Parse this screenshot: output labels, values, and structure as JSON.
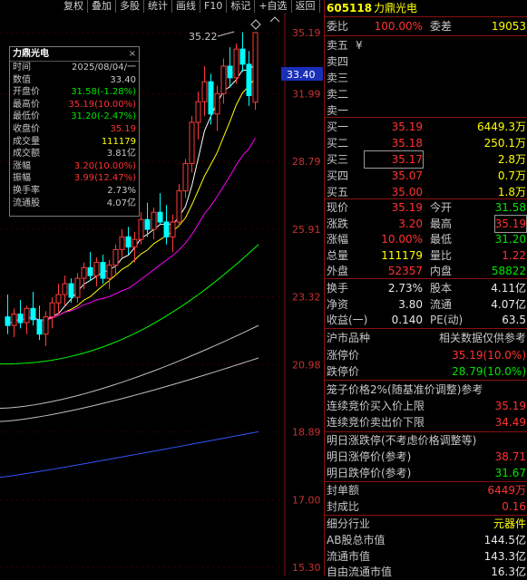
{
  "toolbar": {
    "items": [
      "复权",
      "叠加",
      "多股",
      "统计",
      "画线",
      "F10",
      "标记",
      "+自选",
      "返回"
    ]
  },
  "chart": {
    "y_ticks": [
      "35.19",
      "33.40",
      "31.99",
      "28.79",
      "25.91",
      "23.32",
      "20.98",
      "18.89",
      "17.00",
      "15.30"
    ],
    "current_price": "33.40",
    "high_marker": "35.22",
    "colors": {
      "up": "#ff3c3c",
      "down": "#00ffff",
      "ma5": "#ffffff",
      "ma10": "#ffff00",
      "ma20": "#ff00ff",
      "ma30": "#00ff00",
      "ma60": "#c0c0c0",
      "ma120": "#c0c0c0",
      "ma250": "#3355ff"
    },
    "candles": [
      {
        "o": 22.6,
        "h": 23.4,
        "l": 22.0,
        "c": 22.3
      },
      {
        "o": 22.3,
        "h": 22.9,
        "l": 21.9,
        "c": 22.7
      },
      {
        "o": 22.7,
        "h": 23.2,
        "l": 22.2,
        "c": 22.4
      },
      {
        "o": 22.4,
        "h": 23.0,
        "l": 22.0,
        "c": 22.9
      },
      {
        "o": 22.9,
        "h": 23.5,
        "l": 22.3,
        "c": 22.5
      },
      {
        "o": 22.5,
        "h": 23.0,
        "l": 21.8,
        "c": 22.0
      },
      {
        "o": 22.0,
        "h": 22.8,
        "l": 21.6,
        "c": 22.6
      },
      {
        "o": 22.6,
        "h": 23.3,
        "l": 22.2,
        "c": 23.1
      },
      {
        "o": 23.1,
        "h": 23.8,
        "l": 22.7,
        "c": 23.4
      },
      {
        "o": 23.4,
        "h": 24.1,
        "l": 23.0,
        "c": 23.8
      },
      {
        "o": 23.8,
        "h": 24.0,
        "l": 23.1,
        "c": 23.3
      },
      {
        "o": 23.3,
        "h": 24.2,
        "l": 23.1,
        "c": 24.0
      },
      {
        "o": 24.0,
        "h": 24.6,
        "l": 23.6,
        "c": 24.4
      },
      {
        "o": 24.4,
        "h": 25.0,
        "l": 23.9,
        "c": 24.1
      },
      {
        "o": 24.1,
        "h": 24.8,
        "l": 23.7,
        "c": 24.6
      },
      {
        "o": 24.6,
        "h": 24.9,
        "l": 23.8,
        "c": 24.0
      },
      {
        "o": 24.0,
        "h": 24.7,
        "l": 23.6,
        "c": 24.5
      },
      {
        "o": 24.5,
        "h": 25.3,
        "l": 24.1,
        "c": 25.1
      },
      {
        "o": 25.1,
        "h": 25.9,
        "l": 24.8,
        "c": 25.6
      },
      {
        "o": 25.6,
        "h": 26.0,
        "l": 24.9,
        "c": 25.2
      },
      {
        "o": 25.2,
        "h": 25.8,
        "l": 24.6,
        "c": 25.5
      },
      {
        "o": 25.5,
        "h": 26.6,
        "l": 25.3,
        "c": 26.3
      },
      {
        "o": 26.3,
        "h": 27.0,
        "l": 25.6,
        "c": 25.9
      },
      {
        "o": 25.9,
        "h": 26.8,
        "l": 25.5,
        "c": 26.6
      },
      {
        "o": 26.6,
        "h": 27.4,
        "l": 26.1,
        "c": 26.2
      },
      {
        "o": 26.2,
        "h": 26.9,
        "l": 25.3,
        "c": 25.6
      },
      {
        "o": 25.6,
        "h": 26.5,
        "l": 25.0,
        "c": 26.2
      },
      {
        "o": 26.2,
        "h": 27.8,
        "l": 26.0,
        "c": 27.5
      },
      {
        "o": 27.5,
        "h": 28.9,
        "l": 27.2,
        "c": 28.7
      },
      {
        "o": 28.7,
        "h": 30.9,
        "l": 28.3,
        "c": 30.6
      },
      {
        "o": 30.6,
        "h": 32.1,
        "l": 29.8,
        "c": 31.6
      },
      {
        "o": 31.6,
        "h": 33.4,
        "l": 30.9,
        "c": 32.6
      },
      {
        "o": 32.6,
        "h": 33.0,
        "l": 30.5,
        "c": 31.0
      },
      {
        "o": 31.0,
        "h": 32.4,
        "l": 30.2,
        "c": 32.0
      },
      {
        "o": 32.0,
        "h": 33.8,
        "l": 31.5,
        "c": 33.4
      },
      {
        "o": 33.4,
        "h": 34.4,
        "l": 32.3,
        "c": 32.8
      },
      {
        "o": 32.8,
        "h": 34.6,
        "l": 32.5,
        "c": 34.3
      },
      {
        "o": 34.3,
        "h": 35.22,
        "l": 33.1,
        "c": 33.5
      },
      {
        "o": 33.5,
        "h": 34.2,
        "l": 31.4,
        "c": 31.9
      },
      {
        "o": 31.58,
        "h": 35.19,
        "l": 31.2,
        "c": 35.19
      }
    ]
  },
  "infobox": {
    "title": "力鼎光电",
    "close": "×",
    "rows": [
      {
        "k": "时间",
        "v": "2025/08/04/一",
        "c": "#c8c8c8"
      },
      {
        "k": "数值",
        "v": "33.40",
        "c": "#c8c8c8"
      },
      {
        "k": "开盘价",
        "v": "31.58(-1.28%)",
        "c": "#00e600"
      },
      {
        "k": "最高价",
        "v": "35.19(10.00%)",
        "c": "#ff3232"
      },
      {
        "k": "最低价",
        "v": "31.20(-2.47%)",
        "c": "#00e600"
      },
      {
        "k": "收盘价",
        "v": "35.19",
        "c": "#ff3232"
      },
      {
        "k": "成交量",
        "v": "111179",
        "c": "#ffff00"
      },
      {
        "k": "成交额",
        "v": "3.81亿",
        "c": "#c8c8c8"
      },
      {
        "k": "涨幅",
        "v": "3.20(10.00%)",
        "c": "#ff3232"
      },
      {
        "k": "振幅",
        "v": "3.99(12.47%)",
        "c": "#ff3232"
      },
      {
        "k": "换手率",
        "v": "2.73%",
        "c": "#c8c8c8"
      },
      {
        "k": "流通股",
        "v": "4.07亿",
        "c": "#c8c8c8"
      }
    ]
  },
  "panel": {
    "code": "605118",
    "name": "力鼎光电",
    "weibi_label": "委比",
    "weibi": "100.00%",
    "weicha_label": "委差",
    "weicha": "19053",
    "sells": [
      {
        "label": "卖五",
        "price": "",
        "vol": "",
        "extra": "¥"
      },
      {
        "label": "卖四",
        "price": "",
        "vol": ""
      },
      {
        "label": "卖三",
        "price": "",
        "vol": ""
      },
      {
        "label": "卖二",
        "price": "",
        "vol": ""
      },
      {
        "label": "卖一",
        "price": "",
        "vol": ""
      }
    ],
    "buys": [
      {
        "label": "买一",
        "price": "35.19",
        "vol": "6449.3万"
      },
      {
        "label": "买二",
        "price": "35.18",
        "vol": "250.1万"
      },
      {
        "label": "买三",
        "price": "35.17",
        "vol": "2.8万"
      },
      {
        "label": "买四",
        "price": "35.07",
        "vol": "0.7万"
      },
      {
        "label": "买五",
        "price": "35.00",
        "vol": "1.8万"
      }
    ],
    "quote": [
      {
        "k1": "现价",
        "v1": "35.19",
        "c1": "#ff3232",
        "k2": "今开",
        "v2": "31.58",
        "c2": "#00e600"
      },
      {
        "k1": "涨跌",
        "v1": "3.20",
        "c1": "#ff3232",
        "k2": "最高",
        "v2": "35.19",
        "c2": "#ff3232"
      },
      {
        "k1": "涨幅",
        "v1": "10.00%",
        "c1": "#ff3232",
        "k2": "最低",
        "v2": "31.20",
        "c2": "#00e600"
      },
      {
        "k1": "总量",
        "v1": "111179",
        "c1": "#ffff00",
        "k2": "量比",
        "v2": "1.22",
        "c2": "#ff3232"
      },
      {
        "k1": "外盘",
        "v1": "52357",
        "c1": "#ff3232",
        "k2": "内盘",
        "v2": "58822",
        "c2": "#00e600"
      }
    ],
    "stats": [
      {
        "k1": "换手",
        "v1": "2.73%",
        "k2": "股本",
        "v2": "4.11亿"
      },
      {
        "k1": "净资",
        "v1": "3.80",
        "k2": "流通",
        "v2": "4.07亿"
      },
      {
        "k1": "收益(一)",
        "v1": "0.140",
        "k2": "PE(动)",
        "v2": "63.5"
      }
    ],
    "hs_label": "沪市品种",
    "related_label": "相关数据仅供参考",
    "limit_up_label": "涨停价",
    "limit_up": "35.19(10.0%)",
    "limit_down_label": "跌停价",
    "limit_down": "28.79(10.0%)",
    "cage_title": "笼子价格2%(随基准价调整)参考",
    "cage_buy_label": "连续竞价买入价上限",
    "cage_buy": "35.19",
    "cage_sell_label": "连续竞价卖出价下限",
    "cage_sell": "34.49",
    "next_title": "明日涨跌停(不考虑价格调整等)",
    "next_up_label": "明日涨停价(参考)",
    "next_up": "38.71",
    "next_down_label": "明日跌停价(参考)",
    "next_down": "31.67",
    "seal_amount_label": "封单额",
    "seal_amount": "6449万",
    "seal_ratio_label": "封成比",
    "seal_ratio": "0.16",
    "industry_label": "细分行业",
    "industry": "元器件",
    "ab_cap_label": "AB股总市值",
    "ab_cap": "144.5亿",
    "float_cap_label": "流通市值",
    "float_cap": "143.3亿",
    "free_cap_label": "自由流通市值",
    "free_cap": "16.3亿"
  }
}
